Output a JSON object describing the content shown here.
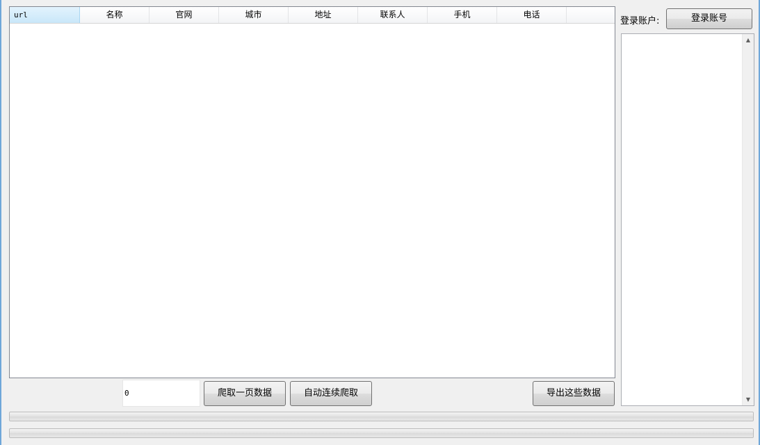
{
  "table": {
    "columns": [
      "url",
      "名称",
      "官网",
      "城市",
      "地址",
      "联系人",
      "手机",
      "电话"
    ],
    "rows": []
  },
  "controls": {
    "page_value": "0",
    "crawl_one_label": "爬取一页数据",
    "auto_crawl_label": "自动连续爬取",
    "export_label": "导出这些数据"
  },
  "account": {
    "label": "登录账户:",
    "login_button": "登录账号"
  },
  "log": {
    "text": ""
  },
  "progress": {
    "bar1_value": 0,
    "bar2_value": 0
  },
  "colors": {
    "accent": "#6fa7d9",
    "header_selected": "#c9e7f9"
  },
  "icons": {
    "scroll_up": "▲",
    "scroll_down": "▼"
  }
}
